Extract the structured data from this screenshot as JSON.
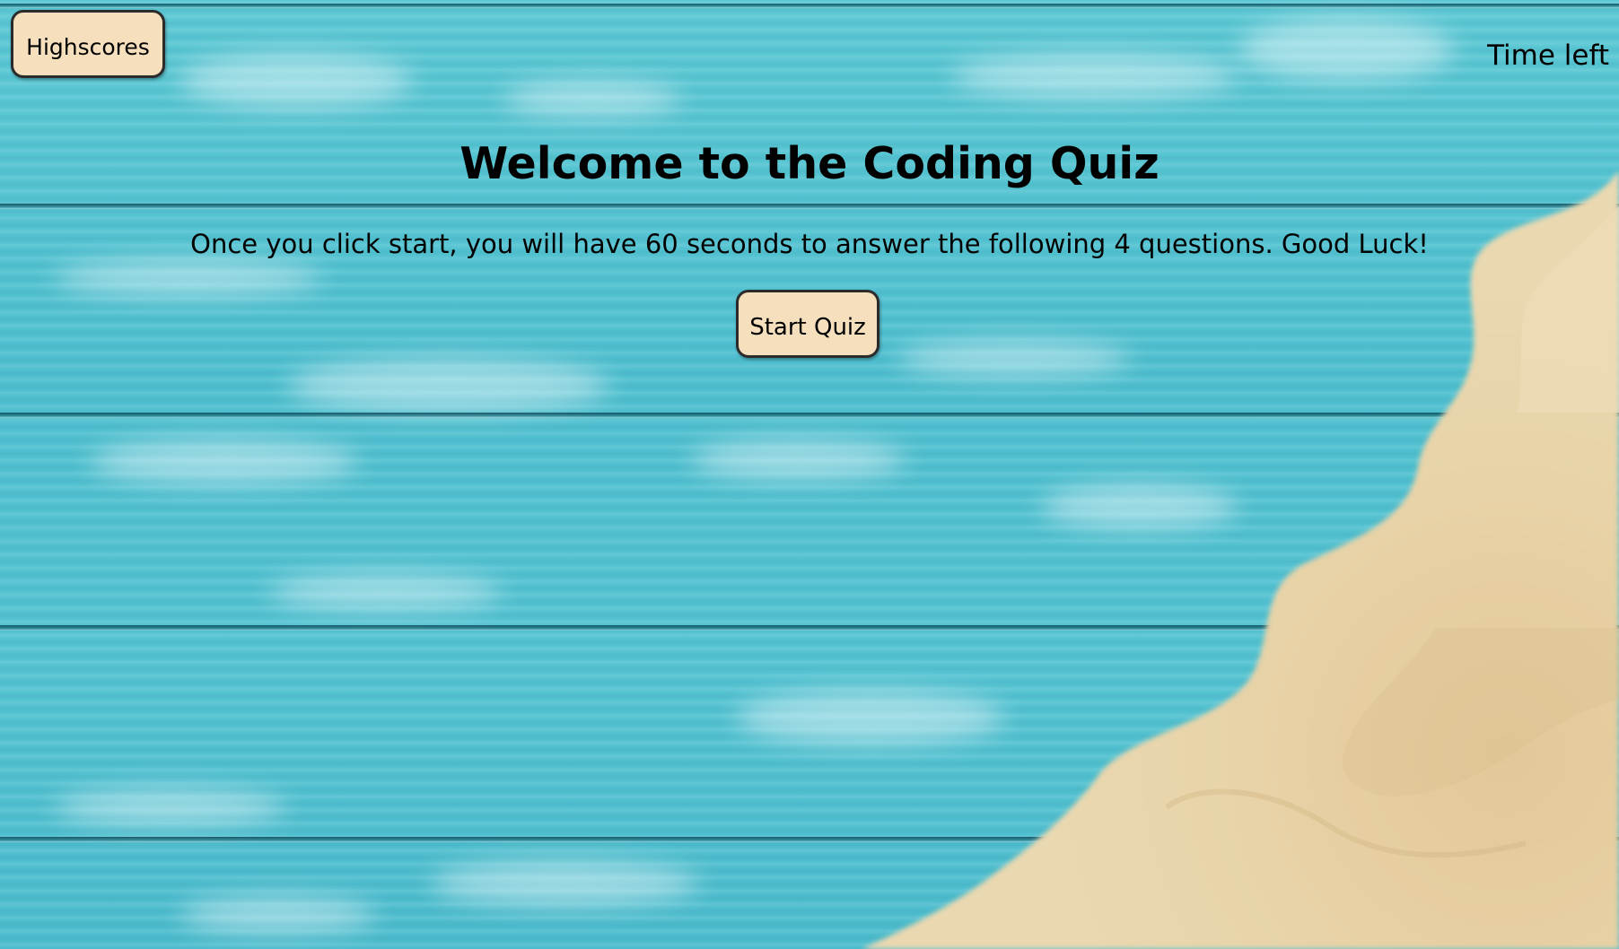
{
  "header": {
    "highscores_label": "Highscores",
    "timer_label": "Time left"
  },
  "main": {
    "title": "Welcome to the Coding Quiz",
    "intro": "Once you click start, you will have 60 seconds to answer the following 4 questions. Good Luck!",
    "start_label": "Start Quiz"
  },
  "colors": {
    "button_fill": "#f6dfbd",
    "button_border": "#2b2b2b",
    "background_teal": "#52c2d1",
    "sand": "#e6cf9f"
  }
}
